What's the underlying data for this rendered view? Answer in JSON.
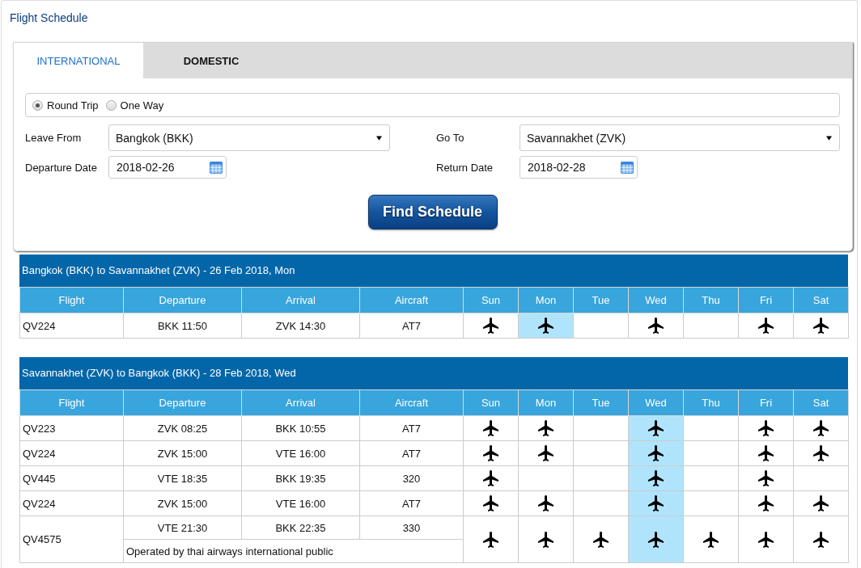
{
  "page": {
    "title": "Flight Schedule"
  },
  "tabs": [
    {
      "label": "INTERNATIONAL",
      "selected": true
    },
    {
      "label": "DOMESTIC",
      "selected": false
    }
  ],
  "trip_type": [
    {
      "label": "Round Trip",
      "selected": true
    },
    {
      "label": "One Way",
      "selected": false
    }
  ],
  "fields": [
    {
      "label": "Leave From",
      "kind": "select",
      "value": "Bangkok (BKK)"
    },
    {
      "label": "Go To",
      "kind": "select",
      "value": "Savannakhet (ZVK)"
    },
    {
      "label": "Departure Date",
      "kind": "date",
      "value": "2018-02-26"
    },
    {
      "label": "Return Date",
      "kind": "date",
      "value": "2018-02-28"
    }
  ],
  "find_button": {
    "label": "Find Schedule"
  },
  "schedules": [
    {
      "title": "Bangkok (BKK) to Savannakhet (ZVK) - 26 Feb 2018, Mon",
      "columns": [
        "Flight",
        "Departure",
        "Arrival",
        "Aircraft"
      ],
      "days": [
        {
          "label": "Sun",
          "selected": false
        },
        {
          "label": "Mon",
          "selected": true
        },
        {
          "label": "Tue",
          "selected": false
        },
        {
          "label": "Wed",
          "selected": false
        },
        {
          "label": "Thu",
          "selected": false
        },
        {
          "label": "Fri",
          "selected": false
        },
        {
          "label": "Sat",
          "selected": false
        }
      ],
      "rows": [
        {
          "flight": "QV224",
          "departure": "BKK 11:50",
          "arrival": "ZVK 14:30",
          "aircraft": "AT7",
          "operates": [
            true,
            true,
            false,
            true,
            false,
            true,
            true
          ]
        }
      ]
    },
    {
      "title": "Savannakhet (ZVK) to Bangkok (BKK) - 28 Feb 2018, Wed",
      "columns": [
        "Flight",
        "Departure",
        "Arrival",
        "Aircraft"
      ],
      "days": [
        {
          "label": "Sun",
          "selected": false
        },
        {
          "label": "Mon",
          "selected": false
        },
        {
          "label": "Tue",
          "selected": false
        },
        {
          "label": "Wed",
          "selected": true
        },
        {
          "label": "Thu",
          "selected": false
        },
        {
          "label": "Fri",
          "selected": false
        },
        {
          "label": "Sat",
          "selected": false
        }
      ],
      "rows": [
        {
          "flight": "QV223",
          "departure": "ZVK 08:25",
          "arrival": "BKK 10:55",
          "aircraft": "AT7",
          "operates": [
            true,
            true,
            false,
            true,
            false,
            true,
            true
          ]
        },
        {
          "flight": "QV224",
          "departure": "ZVK 15:00",
          "arrival": "VTE 16:00",
          "aircraft": "AT7",
          "operates": [
            true,
            true,
            false,
            true,
            false,
            true,
            true
          ]
        },
        {
          "flight": "QV445",
          "departure": "VTE 18:35",
          "arrival": "BKK 19:35",
          "aircraft": "320",
          "operates": [
            true,
            false,
            false,
            true,
            false,
            true,
            false
          ]
        },
        {
          "flight": "QV224",
          "departure": "ZVK 15:00",
          "arrival": "VTE 16:00",
          "aircraft": "AT7",
          "operates": [
            true,
            true,
            false,
            true,
            false,
            true,
            true
          ]
        },
        {
          "flight": "QV4575",
          "departure": "VTE 21:30",
          "arrival": "BKK 22:35",
          "aircraft": "330",
          "note": "Operated by thai airways international public",
          "operates": [
            true,
            true,
            true,
            true,
            true,
            true,
            true
          ]
        }
      ]
    }
  ]
}
